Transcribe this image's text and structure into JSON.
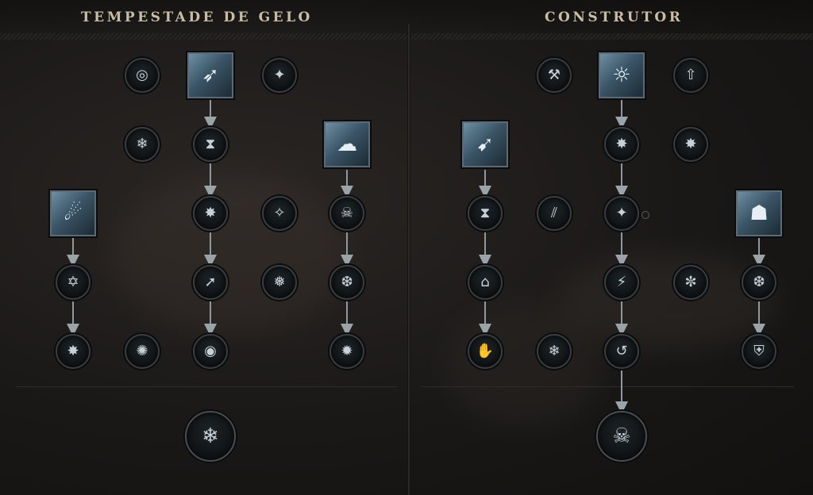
{
  "left_panel": {
    "title": "TEMPESTADE DE GELO",
    "nodes": {
      "r1_orbit": {
        "icon": "orbit-ring-icon",
        "glyph": "◎"
      },
      "r1_shards": {
        "icon": "ice-shards-icon",
        "glyph": "➶"
      },
      "r1_sparkle": {
        "icon": "sparkle-icon",
        "glyph": "✦"
      },
      "r2_snowflake": {
        "icon": "snowflake-icon",
        "glyph": "❄"
      },
      "r2_hourglass": {
        "icon": "hourglass-icon",
        "glyph": "⧗"
      },
      "r2_storm": {
        "icon": "frost-storm-icon",
        "glyph": "☁"
      },
      "r3_comet": {
        "icon": "ice-comet-icon",
        "glyph": "☄"
      },
      "r3_starburst_up": {
        "icon": "starburst-up-icon",
        "glyph": "✸"
      },
      "r3_sparkle_up": {
        "icon": "sparkle-up-icon",
        "glyph": "✧"
      },
      "r3_skull": {
        "icon": "skull-icon",
        "glyph": "☠"
      },
      "r4_hourglass_star": {
        "icon": "hourglass-star-icon",
        "glyph": "✡"
      },
      "r4_arrow_diag": {
        "icon": "arrow-diagonal-icon",
        "glyph": "➚"
      },
      "r4_snowflake_big": {
        "icon": "snowflake-big-icon",
        "glyph": "❅"
      },
      "r4_shield_flake": {
        "icon": "shield-snowflake-icon",
        "glyph": "❆"
      },
      "r5_starburst_up": {
        "icon": "starburst-up-icon",
        "glyph": "✸"
      },
      "r5_snow_crystal": {
        "icon": "snow-crystal-icon",
        "glyph": "✺"
      },
      "r5_ring": {
        "icon": "ring-icon",
        "glyph": "◉"
      },
      "r5_flake_burst": {
        "icon": "snowflake-burst-icon",
        "glyph": "✹"
      },
      "ultimate": {
        "icon": "snowflake-orbit-icon",
        "glyph": "❄"
      }
    }
  },
  "right_panel": {
    "title": "CONSTRUTOR",
    "nodes": {
      "r1_axe": {
        "icon": "axe-shield-icon",
        "glyph": "⚒"
      },
      "r1_pillar": {
        "icon": "light-pillar-icon",
        "glyph": "☼"
      },
      "r1_boot": {
        "icon": "boot-up-icon",
        "glyph": "⇧"
      },
      "r2_dash": {
        "icon": "ice-dash-icon",
        "glyph": "➹"
      },
      "r2_starburst_up": {
        "icon": "starburst-up-icon",
        "glyph": "✸"
      },
      "r2_starburst_up_b": {
        "icon": "starburst-up-icon",
        "glyph": "✸"
      },
      "r3_hourglass_up": {
        "icon": "hourglass-up-icon",
        "glyph": "⧗"
      },
      "r3_claws": {
        "icon": "claw-marks-icon",
        "glyph": "⫽"
      },
      "r3_sparkle": {
        "icon": "sparkle-icon",
        "glyph": "✦"
      },
      "r3_figure": {
        "icon": "frost-figure-icon",
        "glyph": "☗"
      },
      "r4_house_up": {
        "icon": "house-up-icon",
        "glyph": "⌂"
      },
      "r4_runner": {
        "icon": "runner-icon",
        "glyph": "⚡"
      },
      "r4_flake_cycle": {
        "icon": "snowflake-cycle-icon",
        "glyph": "✼"
      },
      "r4_shield_flake": {
        "icon": "shield-snowflake-icon",
        "glyph": "❆"
      },
      "r5_hands": {
        "icon": "hands-icon",
        "glyph": "✋"
      },
      "r5_gate_flake": {
        "icon": "gate-snowflake-icon",
        "glyph": "❄"
      },
      "r5_swirl": {
        "icon": "swirl-arrow-icon",
        "glyph": "↺"
      },
      "r5_shield_sparkle": {
        "icon": "shield-sparkle-icon",
        "glyph": "⛨"
      },
      "ultimate": {
        "icon": "frost-skull-icon",
        "glyph": "☠"
      }
    }
  }
}
